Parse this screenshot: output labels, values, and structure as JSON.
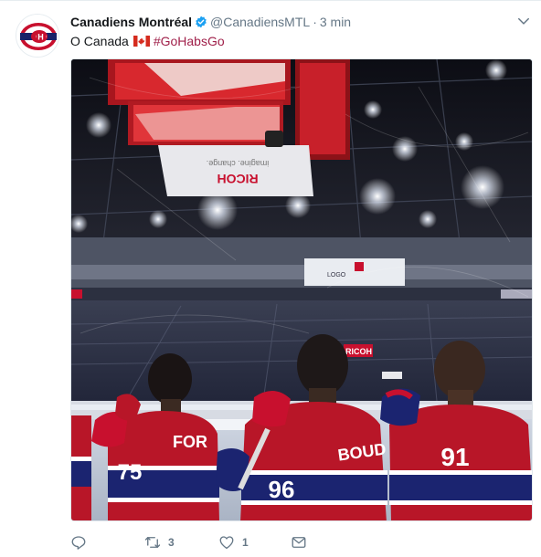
{
  "tweet": {
    "display_name": "Canadiens Montréal",
    "handle": "@CanadiensMTL",
    "separator": "·",
    "time": "3 min",
    "text_before_flag": "O Canada",
    "hashtag": "#GoHabsGo",
    "media": {
      "scoreboard_brand": "RICOH",
      "scoreboard_tagline": "imagine. change.",
      "arena_sign": "RICOH",
      "jerseys": [
        {
          "name": "FOR",
          "number": "75"
        },
        {
          "name": "BOUD",
          "number": "96"
        },
        {
          "number": "91"
        }
      ]
    },
    "actions": {
      "reply_count": "",
      "retweet_count": "3",
      "like_count": "1"
    }
  },
  "colors": {
    "habs_red": "#c8102e",
    "habs_blue": "#192168",
    "hashtag": "#a0204a",
    "verified": "#1da1f2",
    "muted": "#657786"
  },
  "icons": {
    "caret": "chevron-down-icon",
    "verified": "verified-badge-icon",
    "reply": "reply-icon",
    "retweet": "retweet-icon",
    "like": "heart-icon",
    "dm": "envelope-icon"
  }
}
